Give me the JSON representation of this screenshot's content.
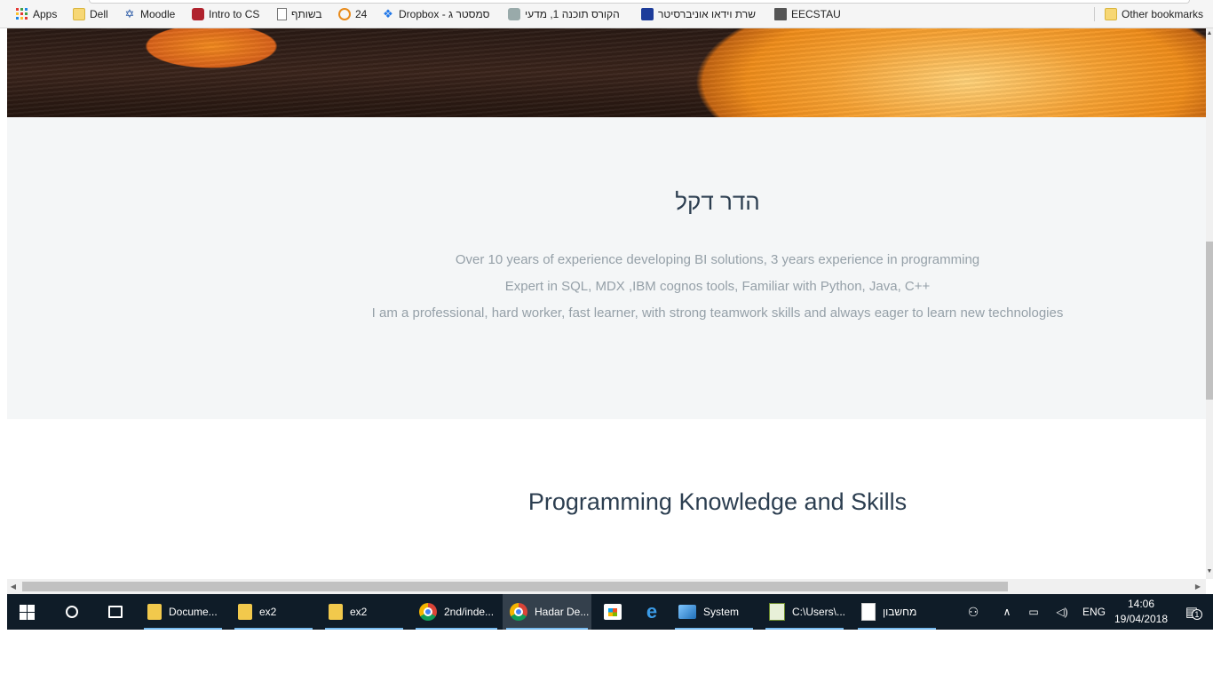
{
  "bookmarks": {
    "items": [
      {
        "label": "Apps",
        "icon": "apps-grid-icon"
      },
      {
        "label": "Dell",
        "icon": "folder-icon"
      },
      {
        "label": "Moodle",
        "icon": "tau-logo-icon"
      },
      {
        "label": "Intro to CS",
        "icon": "intro-cs-icon"
      },
      {
        "label": "בשותף",
        "icon": "page-icon"
      },
      {
        "label": "24",
        "icon": "24-icon"
      },
      {
        "label": "Dropbox - סמסטר ג",
        "icon": "dropbox-icon"
      },
      {
        "label": "הקורס תוכנה 1, מדעי",
        "icon": "course-icon"
      },
      {
        "label": "שרת וידאו אוניברסיטר",
        "icon": "tau-video-icon"
      },
      {
        "label": "EECSTAU",
        "icon": "eecstau-icon"
      }
    ],
    "other": {
      "label": "Other bookmarks",
      "icon": "folder-icon"
    }
  },
  "about": {
    "name": "הדר דקל",
    "lines": [
      "Over 10 years of experience developing BI solutions, 3 years experience in programming",
      "Expert in SQL, MDX ,IBM cognos tools, Familiar with Python, Java, C++",
      "I am a professional, hard worker, fast learner, with strong teamwork skills and always eager to learn new technologies"
    ]
  },
  "skills": {
    "title": "Programming Knowledge and Skills"
  },
  "taskbar": {
    "windows": [
      {
        "label": "Docume...",
        "icon": "documents-icon"
      },
      {
        "label": "ex2",
        "icon": "folder-icon"
      },
      {
        "label": "ex2",
        "icon": "folder-icon"
      },
      {
        "label": "2nd/inde...",
        "icon": "chrome-icon"
      },
      {
        "label": "Hadar De...",
        "icon": "chrome-icon"
      },
      {
        "label": "",
        "icon": "store-icon"
      },
      {
        "label": "",
        "icon": "edge-icon"
      },
      {
        "label": "System",
        "icon": "system-icon"
      },
      {
        "label": "C:\\Users\\...",
        "icon": "notepad-icon"
      },
      {
        "label": "מחשבון",
        "icon": "calculator-icon"
      }
    ],
    "tray": {
      "language": "ENG",
      "time": "14:06",
      "date": "19/04/2018",
      "notifications": "1"
    }
  }
}
